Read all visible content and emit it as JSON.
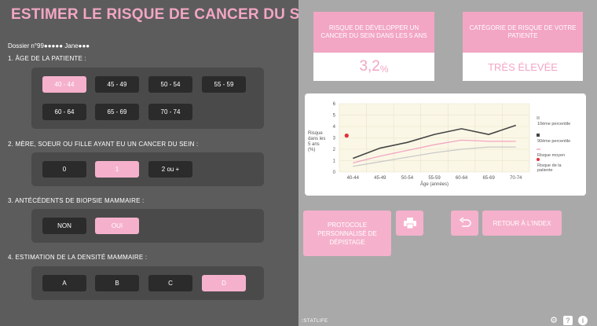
{
  "title": "ESTIMER LE RISQUE DE CANCER DU SEIN",
  "dossier": "Dossier n°99●●●●● Jane●●●",
  "q1": {
    "label": "1. ÂGE DE LA PATIENTE :",
    "options": [
      "40 - 44",
      "45 - 49",
      "50 - 54",
      "55 - 59",
      "60 - 64",
      "65 - 69",
      "70 - 74"
    ],
    "selected": "40 - 44"
  },
  "q2": {
    "label": "2. MÈRE, SOEUR OU FILLE AYANT EU UN CANCER DU SEIN :",
    "options": [
      "0",
      "1",
      "2 ou +"
    ],
    "selected": "1"
  },
  "q3": {
    "label": "3. ANTÉCÉDENTS DE BIOPSIE MAMMAIRE :",
    "options": [
      "NON",
      "OUI"
    ],
    "selected": "OUI"
  },
  "q4": {
    "label": "4. ESTIMATION DE LA DENSITÉ MAMMAIRE :",
    "options": [
      "A",
      "B",
      "C",
      "D"
    ],
    "selected": "D"
  },
  "risk_card": {
    "header": "RISQUE DE DÉVELOPPER UN CANCER DU SEIN DANS LES 5 ANS",
    "value": "3,2",
    "unit": "%"
  },
  "category_card": {
    "header": "CATÉGORIE DE RISQUE DE VOTRE PATIENTE",
    "value": "TRÈS ÉLEVÉE"
  },
  "chart_data": {
    "type": "line",
    "ylabel": "Risque dans les 5 ans (%)",
    "xlabel": "Âge (années)",
    "categories": [
      "40-44",
      "45-49",
      "50-54",
      "55-59",
      "60-64",
      "65-69",
      "70-74"
    ],
    "ylim": [
      0,
      6
    ],
    "yticks": [
      "0",
      "1",
      "2",
      "3",
      "4",
      "5",
      "6"
    ],
    "grid": true,
    "legend_position": "right",
    "series": [
      {
        "name": "10ème percentile",
        "color": "#c9c9c9",
        "values": [
          0.5,
          0.9,
          1.3,
          1.7,
          2.0,
          2.2,
          2.2
        ]
      },
      {
        "name": "90ème percentile",
        "color": "#444444",
        "values": [
          1.2,
          2.1,
          2.6,
          3.3,
          3.8,
          3.3,
          4.1
        ]
      },
      {
        "name": "Risque moyen",
        "color": "#f2a6c3",
        "values": [
          0.8,
          1.4,
          1.9,
          2.4,
          2.8,
          2.7,
          2.7
        ]
      }
    ],
    "patient_point": {
      "name": "Risque de la patiente",
      "category": "40-44",
      "value": 3.2,
      "color": "#e0303a"
    }
  },
  "buttons": {
    "protocole": "PROTOCOLE PERSONNALISÉ DE DÉPISTAGE",
    "retour": "RETOUR À L'INDEX"
  },
  "footer": {
    "logo": "STATLIFE"
  }
}
